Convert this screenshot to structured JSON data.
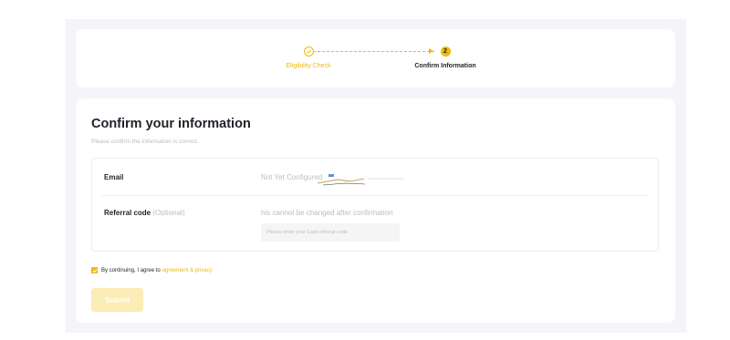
{
  "stepper": {
    "steps": [
      {
        "label": "Eligibility Check",
        "state": "done"
      },
      {
        "label": "Confirm Information",
        "state": "current",
        "number": "2"
      }
    ]
  },
  "form": {
    "title": "Confirm your information",
    "subtitle": "Please confirm the information is correct.",
    "email": {
      "label": "Email",
      "value": "Not Yet Configured"
    },
    "referral": {
      "label": "Referral code",
      "optional": "(Optional)",
      "note": "his cannot be changed after confirmation",
      "placeholder": "Please enter your Card referral code"
    },
    "agreement": {
      "checked": true,
      "text": "By continuing, I agree to",
      "link": "agreement & privacy"
    },
    "submit_label": "Submit"
  },
  "colors": {
    "accent": "#f0b90b",
    "submit_disabled": "#fcecb5",
    "page_background": "#f4f5f9"
  }
}
